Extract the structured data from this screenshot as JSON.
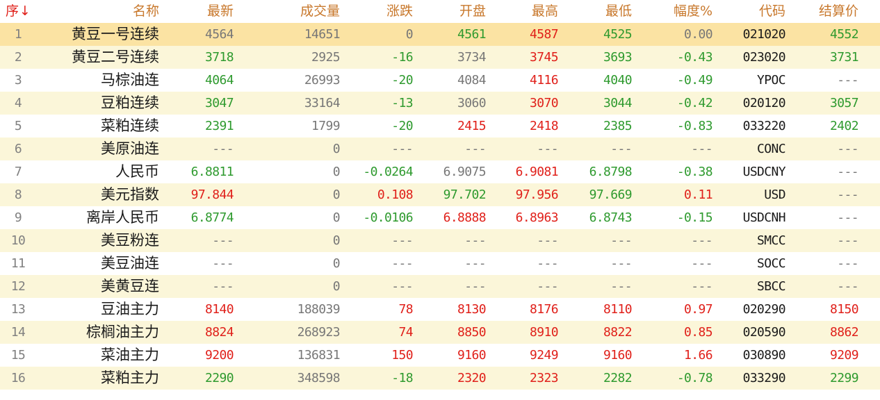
{
  "columns": [
    {
      "key": "seq",
      "label": "序",
      "sort_indicator": "↓"
    },
    {
      "key": "name",
      "label": "名称"
    },
    {
      "key": "latest",
      "label": "最新"
    },
    {
      "key": "volume",
      "label": "成交量"
    },
    {
      "key": "change",
      "label": "涨跌"
    },
    {
      "key": "open",
      "label": "开盘"
    },
    {
      "key": "high",
      "label": "最高"
    },
    {
      "key": "low",
      "label": "最低"
    },
    {
      "key": "pct",
      "label": "幅度%"
    },
    {
      "key": "code",
      "label": "代码"
    },
    {
      "key": "settle",
      "label": "结算价"
    }
  ],
  "colors": {
    "up": "#e0201a",
    "down": "#2e9a2e",
    "flat": "#777777",
    "header_text": "#c8782c",
    "selected_row_bg": "#fbe3a3",
    "alt_row_bg": "#fbf6d9"
  },
  "selected_row": 1,
  "rows": [
    {
      "seq": "1",
      "name": "黄豆一号连续",
      "latest": "4564",
      "volume": "14651",
      "change": "0",
      "open": "4561",
      "high": "4587",
      "low": "4525",
      "pct": "0.00",
      "code": "021020",
      "settle": "4552",
      "colors": {
        "latest": "flat",
        "volume": "flat",
        "change": "flat",
        "open": "down",
        "high": "up",
        "low": "down",
        "pct": "flat",
        "settle": "down"
      }
    },
    {
      "seq": "2",
      "name": "黄豆二号连续",
      "latest": "3718",
      "volume": "2925",
      "change": "-16",
      "open": "3734",
      "high": "3745",
      "low": "3693",
      "pct": "-0.43",
      "code": "023020",
      "settle": "3731",
      "colors": {
        "latest": "down",
        "volume": "flat",
        "change": "down",
        "open": "flat",
        "high": "up",
        "low": "down",
        "pct": "down",
        "settle": "down"
      }
    },
    {
      "seq": "3",
      "name": "马棕油连",
      "latest": "4064",
      "volume": "26993",
      "change": "-20",
      "open": "4084",
      "high": "4116",
      "low": "4040",
      "pct": "-0.49",
      "code": "YPOC",
      "settle": "---",
      "colors": {
        "latest": "down",
        "volume": "flat",
        "change": "down",
        "open": "flat",
        "high": "up",
        "low": "down",
        "pct": "down",
        "settle": "flat"
      }
    },
    {
      "seq": "4",
      "name": "豆粕连续",
      "latest": "3047",
      "volume": "33164",
      "change": "-13",
      "open": "3060",
      "high": "3070",
      "low": "3044",
      "pct": "-0.42",
      "code": "020120",
      "settle": "3057",
      "colors": {
        "latest": "down",
        "volume": "flat",
        "change": "down",
        "open": "flat",
        "high": "up",
        "low": "down",
        "pct": "down",
        "settle": "down"
      }
    },
    {
      "seq": "5",
      "name": "菜粕连续",
      "latest": "2391",
      "volume": "1799",
      "change": "-20",
      "open": "2415",
      "high": "2418",
      "low": "2385",
      "pct": "-0.83",
      "code": "033220",
      "settle": "2402",
      "colors": {
        "latest": "down",
        "volume": "flat",
        "change": "down",
        "open": "up",
        "high": "up",
        "low": "down",
        "pct": "down",
        "settle": "down"
      }
    },
    {
      "seq": "6",
      "name": "美原油连",
      "latest": "---",
      "volume": "0",
      "change": "---",
      "open": "---",
      "high": "---",
      "low": "---",
      "pct": "---",
      "code": "CONC",
      "settle": "---",
      "colors": {
        "latest": "flat",
        "volume": "flat",
        "change": "flat",
        "open": "flat",
        "high": "flat",
        "low": "flat",
        "pct": "flat",
        "settle": "flat"
      }
    },
    {
      "seq": "7",
      "name": "人民币",
      "latest": "6.8811",
      "volume": "0",
      "change": "-0.0264",
      "open": "6.9075",
      "high": "6.9081",
      "low": "6.8798",
      "pct": "-0.38",
      "code": "USDCNY",
      "settle": "---",
      "colors": {
        "latest": "down",
        "volume": "flat",
        "change": "down",
        "open": "flat",
        "high": "up",
        "low": "down",
        "pct": "down",
        "settle": "flat"
      }
    },
    {
      "seq": "8",
      "name": "美元指数",
      "latest": "97.844",
      "volume": "0",
      "change": "0.108",
      "open": "97.702",
      "high": "97.956",
      "low": "97.669",
      "pct": "0.11",
      "code": "USD",
      "settle": "---",
      "colors": {
        "latest": "up",
        "volume": "flat",
        "change": "up",
        "open": "down",
        "high": "up",
        "low": "down",
        "pct": "up",
        "settle": "flat"
      }
    },
    {
      "seq": "9",
      "name": "离岸人民币",
      "latest": "6.8774",
      "volume": "0",
      "change": "-0.0106",
      "open": "6.8888",
      "high": "6.8963",
      "low": "6.8743",
      "pct": "-0.15",
      "code": "USDCNH",
      "settle": "---",
      "colors": {
        "latest": "down",
        "volume": "flat",
        "change": "down",
        "open": "up",
        "high": "up",
        "low": "down",
        "pct": "down",
        "settle": "flat"
      }
    },
    {
      "seq": "10",
      "name": "美豆粉连",
      "latest": "---",
      "volume": "0",
      "change": "---",
      "open": "---",
      "high": "---",
      "low": "---",
      "pct": "---",
      "code": "SMCC",
      "settle": "---",
      "colors": {
        "latest": "flat",
        "volume": "flat",
        "change": "flat",
        "open": "flat",
        "high": "flat",
        "low": "flat",
        "pct": "flat",
        "settle": "flat"
      }
    },
    {
      "seq": "11",
      "name": "美豆油连",
      "latest": "---",
      "volume": "0",
      "change": "---",
      "open": "---",
      "high": "---",
      "low": "---",
      "pct": "---",
      "code": "SOCC",
      "settle": "---",
      "colors": {
        "latest": "flat",
        "volume": "flat",
        "change": "flat",
        "open": "flat",
        "high": "flat",
        "low": "flat",
        "pct": "flat",
        "settle": "flat"
      }
    },
    {
      "seq": "12",
      "name": "美黄豆连",
      "latest": "---",
      "volume": "0",
      "change": "---",
      "open": "---",
      "high": "---",
      "low": "---",
      "pct": "---",
      "code": "SBCC",
      "settle": "---",
      "colors": {
        "latest": "flat",
        "volume": "flat",
        "change": "flat",
        "open": "flat",
        "high": "flat",
        "low": "flat",
        "pct": "flat",
        "settle": "flat"
      }
    },
    {
      "seq": "13",
      "name": "豆油主力",
      "latest": "8140",
      "volume": "188039",
      "change": "78",
      "open": "8130",
      "high": "8176",
      "low": "8110",
      "pct": "0.97",
      "code": "020290",
      "settle": "8150",
      "colors": {
        "latest": "up",
        "volume": "flat",
        "change": "up",
        "open": "up",
        "high": "up",
        "low": "up",
        "pct": "up",
        "settle": "up"
      }
    },
    {
      "seq": "14",
      "name": "棕榈油主力",
      "latest": "8824",
      "volume": "268923",
      "change": "74",
      "open": "8850",
      "high": "8910",
      "low": "8822",
      "pct": "0.85",
      "code": "020590",
      "settle": "8862",
      "colors": {
        "latest": "up",
        "volume": "flat",
        "change": "up",
        "open": "up",
        "high": "up",
        "low": "up",
        "pct": "up",
        "settle": "up"
      }
    },
    {
      "seq": "15",
      "name": "菜油主力",
      "latest": "9200",
      "volume": "136831",
      "change": "150",
      "open": "9160",
      "high": "9249",
      "low": "9160",
      "pct": "1.66",
      "code": "030890",
      "settle": "9209",
      "colors": {
        "latest": "up",
        "volume": "flat",
        "change": "up",
        "open": "up",
        "high": "up",
        "low": "up",
        "pct": "up",
        "settle": "up"
      }
    },
    {
      "seq": "16",
      "name": "菜粕主力",
      "latest": "2290",
      "volume": "348598",
      "change": "-18",
      "open": "2320",
      "high": "2323",
      "low": "2282",
      "pct": "-0.78",
      "code": "033290",
      "settle": "2299",
      "colors": {
        "latest": "down",
        "volume": "flat",
        "change": "down",
        "open": "up",
        "high": "up",
        "low": "down",
        "pct": "down",
        "settle": "down"
      }
    }
  ]
}
